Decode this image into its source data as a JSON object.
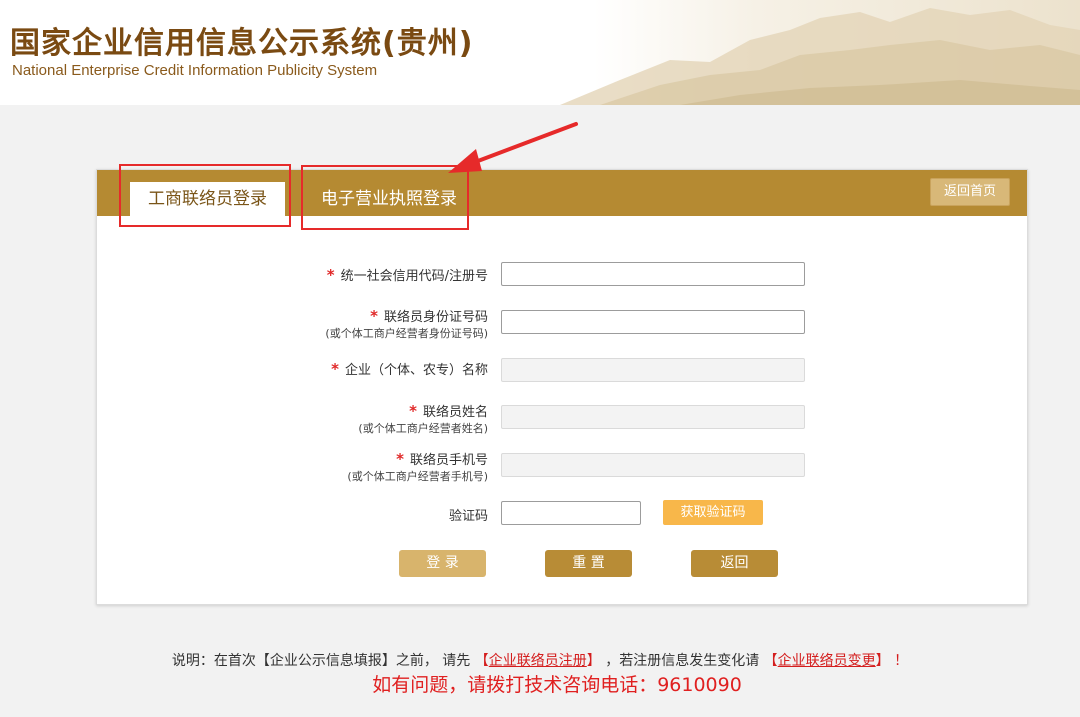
{
  "header": {
    "title": "国家企业信用信息公示系统(贵州)",
    "subtitle": "National Enterprise Credit Information Publicity System"
  },
  "panel": {
    "tab_active": "工商联络员登录",
    "tab_inactive": "电子营业执照登录",
    "home_button": "返回首页"
  },
  "form": {
    "rows": [
      {
        "label": "统一社会信用代码/注册号",
        "sub": "",
        "required": true,
        "disabled": false
      },
      {
        "label": "联络员身份证号码",
        "sub": "(或个体工商户经营者身份证号码)",
        "required": true,
        "disabled": false
      },
      {
        "label": "企业（个体、农专）名称",
        "sub": "",
        "required": true,
        "disabled": true
      },
      {
        "label": "联络员姓名",
        "sub": "(或个体工商户经营者姓名)",
        "required": true,
        "disabled": true
      },
      {
        "label": "联络员手机号",
        "sub": "(或个体工商户经营者手机号)",
        "required": true,
        "disabled": true
      }
    ],
    "captcha_label": "验证码",
    "captcha_button": "获取验证码",
    "required_mark": "*"
  },
  "actions": {
    "login": "登 录",
    "reset": "重 置",
    "back": "返回"
  },
  "footer": {
    "notice_prefix": "说明：在首次【企业公示信息填报】之前， 请先 ",
    "register_link": "企业联络员注册",
    "notice_middle": " ，若注册信息发生变化请 ",
    "change_link": "企业联络员变更",
    "notice_suffix": " ！",
    "hotline": "如有问题，请拨打技术咨询电话：9610090"
  },
  "colors": {
    "brand_gold": "#b58a32",
    "brand_brown": "#7a4a12",
    "captcha_orange": "#f8b74a",
    "alert_red": "#e62a2a"
  }
}
